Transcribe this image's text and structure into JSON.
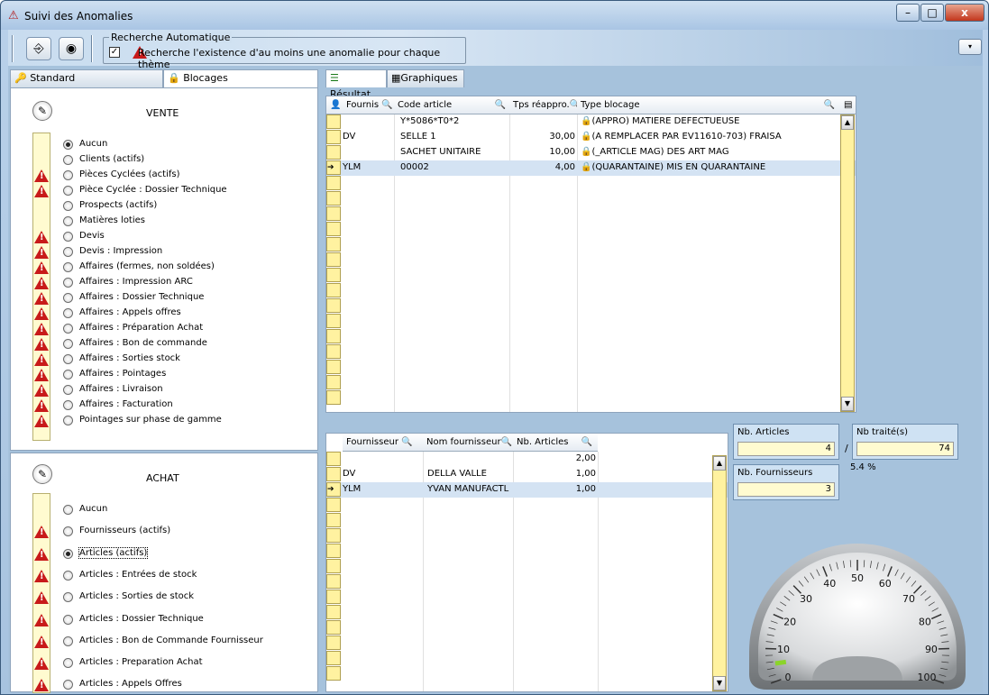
{
  "window": {
    "title": "Suivi des Anomalies",
    "minimize": "–",
    "maximize": "□",
    "close": "x"
  },
  "toolbar": {
    "exit_icon": "exit-icon",
    "refresh_icon": "disc-icon"
  },
  "auto_search": {
    "legend": "Recherche Automatique",
    "checked": true,
    "label": "Recherche l'existence d'au moins une anomalie pour chaque thème"
  },
  "tabs_left": [
    {
      "label": "Standard",
      "icon": "key-icon"
    },
    {
      "label": "Blocages",
      "icon": "lock-icon"
    }
  ],
  "tabs_right": [
    {
      "label": "Résultat",
      "icon": "list-icon"
    },
    {
      "label": "Graphiques",
      "icon": "chart-icon"
    }
  ],
  "vente": {
    "title": "VENTE",
    "items": [
      {
        "label": "Aucun",
        "selected": true,
        "warn": false
      },
      {
        "label": "Clients (actifs)",
        "selected": false,
        "warn": false
      },
      {
        "label": "Pièces Cyclées (actifs)",
        "selected": false,
        "warn": true
      },
      {
        "label": "Pièce Cyclée : Dossier Technique",
        "selected": false,
        "warn": true
      },
      {
        "label": "Prospects (actifs)",
        "selected": false,
        "warn": false
      },
      {
        "label": "Matières loties",
        "selected": false,
        "warn": false
      },
      {
        "label": "Devis",
        "selected": false,
        "warn": true
      },
      {
        "label": "Devis : Impression",
        "selected": false,
        "warn": true
      },
      {
        "label": "Affaires (fermes, non soldées)",
        "selected": false,
        "warn": true
      },
      {
        "label": "Affaires : Impression ARC",
        "selected": false,
        "warn": true
      },
      {
        "label": "Affaires : Dossier Technique",
        "selected": false,
        "warn": true
      },
      {
        "label": "Affaires : Appels offres",
        "selected": false,
        "warn": true
      },
      {
        "label": "Affaires : Préparation Achat",
        "selected": false,
        "warn": true
      },
      {
        "label": "Affaires : Bon de commande",
        "selected": false,
        "warn": true
      },
      {
        "label": "Affaires : Sorties stock",
        "selected": false,
        "warn": true
      },
      {
        "label": "Affaires : Pointages",
        "selected": false,
        "warn": true
      },
      {
        "label": "Affaires : Livraison",
        "selected": false,
        "warn": true
      },
      {
        "label": "Affaires : Facturation",
        "selected": false,
        "warn": true
      },
      {
        "label": "Pointages sur phase de gamme",
        "selected": false,
        "warn": true
      }
    ]
  },
  "achat": {
    "title": "ACHAT",
    "items": [
      {
        "label": "Aucun",
        "selected": false,
        "warn": false
      },
      {
        "label": "Fournisseurs (actifs)",
        "selected": false,
        "warn": true
      },
      {
        "label": "Articles (actifs)",
        "selected": true,
        "warn": true
      },
      {
        "label": "Articles : Entrées de stock",
        "selected": false,
        "warn": true
      },
      {
        "label": "Articles : Sorties de stock",
        "selected": false,
        "warn": true
      },
      {
        "label": "Articles : Dossier Technique",
        "selected": false,
        "warn": true
      },
      {
        "label": "Articles : Bon de Commande Fournisseur",
        "selected": false,
        "warn": true
      },
      {
        "label": "Articles : Preparation Achat",
        "selected": false,
        "warn": true
      },
      {
        "label": "Articles : Appels Offres",
        "selected": false,
        "warn": true
      }
    ]
  },
  "grid1": {
    "headers": [
      "Fournis",
      "Code article",
      "Tps réappro.",
      "Type blocage"
    ],
    "rows": [
      {
        "fournis": "",
        "code": "Y*5086*T0*2",
        "tps": "",
        "type": "(APPRO) MATIERE DEFECTUEUSE",
        "selected": false
      },
      {
        "fournis": "DV",
        "code": "SELLE 1",
        "tps": "30,00",
        "type": "(A REMPLACER PAR EV11610-703) FRAISA",
        "selected": false
      },
      {
        "fournis": "",
        "code": "SACHET UNITAIRE",
        "tps": "10,00",
        "type": "(_ARTICLE MAG) DES  ART MAG",
        "selected": false
      },
      {
        "fournis": "YLM",
        "code": "00002",
        "tps": "4,00",
        "type": "(QUARANTAINE) MIS EN QUARANTAINE",
        "selected": true
      }
    ]
  },
  "grid2": {
    "headers": [
      "Fournisseur",
      "Nom fournisseur",
      "Nb. Articles"
    ],
    "rows": [
      {
        "fournisseur": "",
        "nom": "",
        "nb": "2,00",
        "selected": false
      },
      {
        "fournisseur": "DV",
        "nom": "DELLA VALLE",
        "nb": "1,00",
        "selected": false
      },
      {
        "fournisseur": "YLM",
        "nom": "YVAN MANUFACTL",
        "nb": "1,00",
        "selected": true
      }
    ]
  },
  "stats": {
    "nb_articles_label": "Nb. Articles",
    "nb_articles": "4",
    "slash": "/",
    "nb_traites_label": "Nb traité(s)",
    "nb_traites": "74",
    "percent": "5.4 %",
    "nb_fournisseurs_label": "Nb. Fournisseurs",
    "nb_fournisseurs": "3"
  },
  "gauge": {
    "ticks": [
      "0",
      "10",
      "20",
      "30",
      "40",
      "50",
      "60",
      "70",
      "80",
      "90",
      "100"
    ],
    "value": 5.4
  }
}
